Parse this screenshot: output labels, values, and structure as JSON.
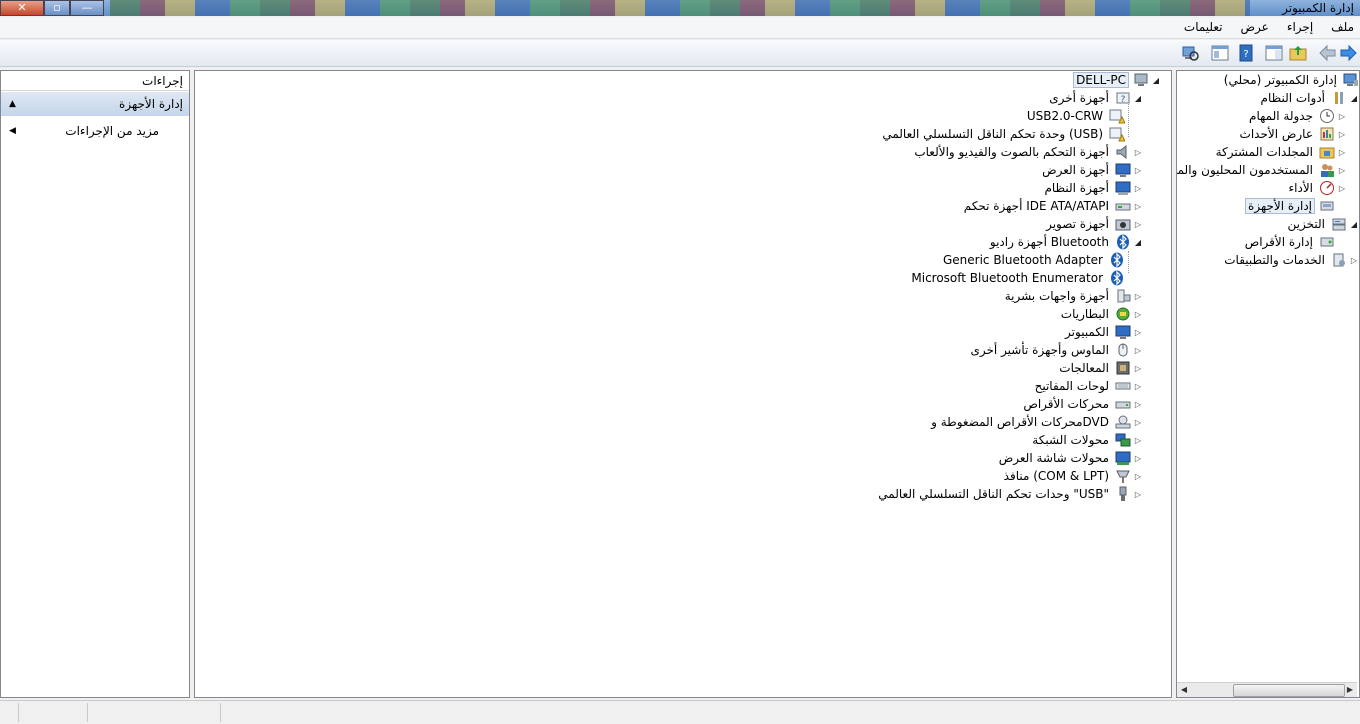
{
  "window": {
    "title": "إدارة الكمبيوتر"
  },
  "menubar": {
    "items": [
      "ملف",
      "إجراء",
      "عرض",
      "تعليمات"
    ]
  },
  "nav_tree": [
    {
      "label": "إدارة الكمبيوتر (محلي)",
      "icon": "computer-management-icon",
      "level": 0,
      "expander": ""
    },
    {
      "label": "أدوات النظام",
      "icon": "system-tools-icon",
      "level": 1,
      "expander": "◢"
    },
    {
      "label": "جدولة المهام",
      "icon": "task-scheduler-icon",
      "level": 2,
      "expander": "▷"
    },
    {
      "label": "عارض الأحداث",
      "icon": "event-viewer-icon",
      "level": 2,
      "expander": "▷"
    },
    {
      "label": "المجلدات المشتركة",
      "icon": "shared-folders-icon",
      "level": 2,
      "expander": "▷"
    },
    {
      "label": "المستخدمون المحليون والمجم",
      "icon": "local-users-icon",
      "level": 2,
      "expander": "▷"
    },
    {
      "label": "الأداء",
      "icon": "performance-icon",
      "level": 2,
      "expander": "▷"
    },
    {
      "label": "إدارة الأجهزة",
      "icon": "device-manager-icon",
      "level": 2,
      "expander": "",
      "selected": true
    },
    {
      "label": "التخزين",
      "icon": "storage-icon",
      "level": 1,
      "expander": "◢"
    },
    {
      "label": "إدارة الأقراص",
      "icon": "disk-management-icon",
      "level": 2,
      "expander": ""
    },
    {
      "label": "الخدمات والتطبيقات",
      "icon": "services-apps-icon",
      "level": 1,
      "expander": "▷"
    }
  ],
  "device_tree": [
    {
      "label": "DELL-PC",
      "icon": "pc-icon",
      "level": 0,
      "expander": "◢",
      "selected": true
    },
    {
      "label": "أجهزة أخرى",
      "icon": "unknown-device-icon",
      "level": 1,
      "expander": "◢"
    },
    {
      "label": "USB2.0-CRW",
      "icon": "warning-device-icon",
      "level": 2,
      "expander": ""
    },
    {
      "label": "وحدة تحكم الناقل التسلسلي العالمي (USB)",
      "icon": "warning-device-icon",
      "level": 2,
      "expander": ""
    },
    {
      "label": "أجهزة التحكم بالصوت والفيديو والألعاب",
      "icon": "speaker-icon",
      "level": 1,
      "expander": "▷"
    },
    {
      "label": "أجهزة العرض",
      "icon": "monitor-icon",
      "level": 1,
      "expander": "▷"
    },
    {
      "label": "أجهزة النظام",
      "icon": "system-device-icon",
      "level": 1,
      "expander": "▷"
    },
    {
      "label": "أجهزة تحكم IDE ATA/ATAPI",
      "icon": "ide-controller-icon",
      "level": 1,
      "expander": "▷"
    },
    {
      "label": "أجهزة تصوير",
      "icon": "camera-icon",
      "level": 1,
      "expander": "▷"
    },
    {
      "label": "أجهزة راديو Bluetooth",
      "icon": "bluetooth-icon",
      "level": 1,
      "expander": "◢"
    },
    {
      "label": "Generic Bluetooth Adapter",
      "icon": "bluetooth-icon",
      "level": 2,
      "expander": ""
    },
    {
      "label": "Microsoft Bluetooth Enumerator",
      "icon": "bluetooth-icon",
      "level": 2,
      "expander": ""
    },
    {
      "label": "أجهزة واجهات بشرية",
      "icon": "hid-icon",
      "level": 1,
      "expander": "▷"
    },
    {
      "label": "البطاريات",
      "icon": "battery-icon",
      "level": 1,
      "expander": "▷"
    },
    {
      "label": "الكمبيوتر",
      "icon": "computer-icon",
      "level": 1,
      "expander": "▷"
    },
    {
      "label": "الماوس وأجهزة تأشير أخرى",
      "icon": "mouse-icon",
      "level": 1,
      "expander": "▷"
    },
    {
      "label": "المعالجات",
      "icon": "processor-icon",
      "level": 1,
      "expander": "▷"
    },
    {
      "label": "لوحات المفاتيح",
      "icon": "keyboard-icon",
      "level": 1,
      "expander": "▷"
    },
    {
      "label": "محركات الأقراص",
      "icon": "disk-drive-icon",
      "level": 1,
      "expander": "▷"
    },
    {
      "label": "محركات الأقراص المضغوطة وDVD",
      "icon": "dvd-drive-icon",
      "level": 1,
      "expander": "▷"
    },
    {
      "label": "محولات الشبكة",
      "icon": "network-adapter-icon",
      "level": 1,
      "expander": "▷"
    },
    {
      "label": "محولات شاشة العرض",
      "icon": "display-adapter-icon",
      "level": 1,
      "expander": "▷"
    },
    {
      "label": "منافذ (COM & LPT)",
      "icon": "port-icon",
      "level": 1,
      "expander": "▷"
    },
    {
      "label": "وحدات تحكم الناقل التسلسلي العالمي \"USB\"",
      "icon": "usb-icon",
      "level": 1,
      "expander": "▷"
    }
  ],
  "actions": {
    "title": "إجراءات",
    "section": "إدارة الأجهزة",
    "more": "مزيد من الإجراءات"
  },
  "colors": {
    "accent": "#3a78c9",
    "selection": "#e6eef7"
  }
}
